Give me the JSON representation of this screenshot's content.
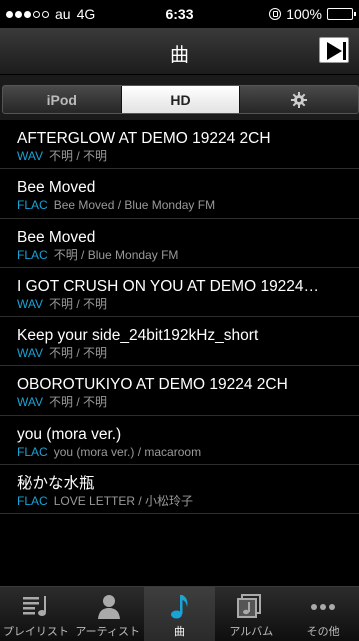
{
  "status": {
    "carrier": "au",
    "network": "4G",
    "time": "6:33",
    "battery": "100%"
  },
  "nav": {
    "title": "曲",
    "play_icon": "now-playing-icon"
  },
  "segments": [
    {
      "label": "iPod"
    },
    {
      "label": "HD"
    },
    {
      "label": "",
      "icon": "gear-icon"
    }
  ],
  "songs": [
    {
      "title": "AFTERGLOW AT DEMO 19224 2CH",
      "format": "WAV",
      "meta": "不明 / 不明"
    },
    {
      "title": "Bee Moved",
      "format": "FLAC",
      "meta": "Bee Moved / Blue Monday FM"
    },
    {
      "title": "Bee Moved",
      "format": "FLAC",
      "meta": "不明 / Blue Monday FM"
    },
    {
      "title": "I GOT CRUSH ON YOU AT DEMO 19224…",
      "format": "WAV",
      "meta": "不明 / 不明"
    },
    {
      "title": "Keep your side_24bit192kHz_short",
      "format": "WAV",
      "meta": "不明 / 不明"
    },
    {
      "title": "OBOROTUKIYO AT DEMO 19224 2CH",
      "format": "WAV",
      "meta": "不明 / 不明"
    },
    {
      "title": "you (mora ver.)",
      "format": "FLAC",
      "meta": "you (mora ver.) / macaroom"
    },
    {
      "title": "秘かな水瓶",
      "format": "FLAC",
      "meta": "LOVE LETTER / 小松玲子"
    }
  ],
  "tabs": [
    {
      "label": "プレイリスト",
      "icon": "playlist-icon"
    },
    {
      "label": "アーティスト",
      "icon": "artist-icon"
    },
    {
      "label": "曲",
      "icon": "music-note-icon"
    },
    {
      "label": "アルバム",
      "icon": "album-icon"
    },
    {
      "label": "その他",
      "icon": "more-icon"
    }
  ],
  "colors": {
    "accent": "#1aa3d6",
    "meta": "#9a9a9a"
  }
}
